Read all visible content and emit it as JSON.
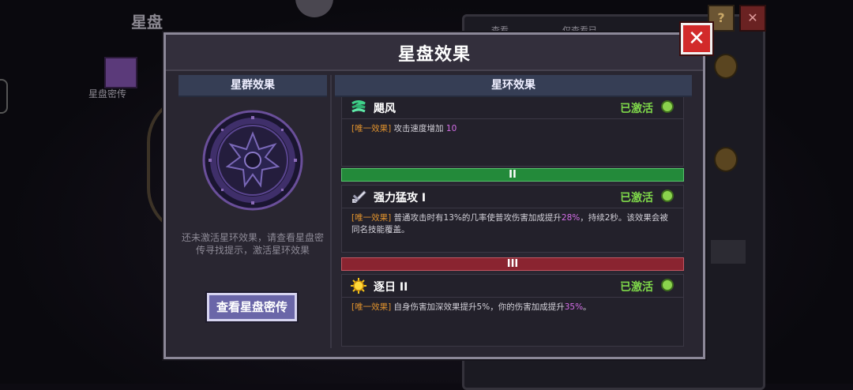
{
  "background": {
    "title": "星盘",
    "book_label": "星盘密传",
    "chip_left": "查看",
    "chip_right": "仅查看已"
  },
  "modal": {
    "title": "星盘效果",
    "close_label": "✕"
  },
  "left_panel": {
    "header": "星群效果",
    "hint": "还未激活星环效果，请查看星盘密传寻找提示，激活星环效果",
    "button_label": "查看星盘密传"
  },
  "right_panel": {
    "header": "星环效果",
    "skills": [
      {
        "name": "飓风",
        "status": "已激活",
        "tag": "[唯一效果]",
        "desc_pre": " 攻击速度增加 ",
        "desc_hl": "10",
        "desc_post": ""
      },
      {
        "tier": "II",
        "name": "强力猛攻 I",
        "status": "已激活",
        "tag": "[唯一效果]",
        "desc_pre": " 普通攻击时有13%的几率使普攻伤害加成提升",
        "desc_hl": "28%",
        "desc_post": "，持续2秒。该效果会被同名技能覆盖。"
      },
      {
        "tier": "III",
        "name": "逐日 II",
        "status": "已激活",
        "tag": "[唯一效果]",
        "desc_pre": " 自身伤害加深效果提升5%，你的伤害加成提升",
        "desc_hl": "35%",
        "desc_post": "。"
      }
    ]
  },
  "colors": {
    "active_green": "#7fd84a",
    "tag_orange": "#e0922d",
    "highlight_purple": "#d46ee8",
    "close_red": "#d22a2a"
  }
}
